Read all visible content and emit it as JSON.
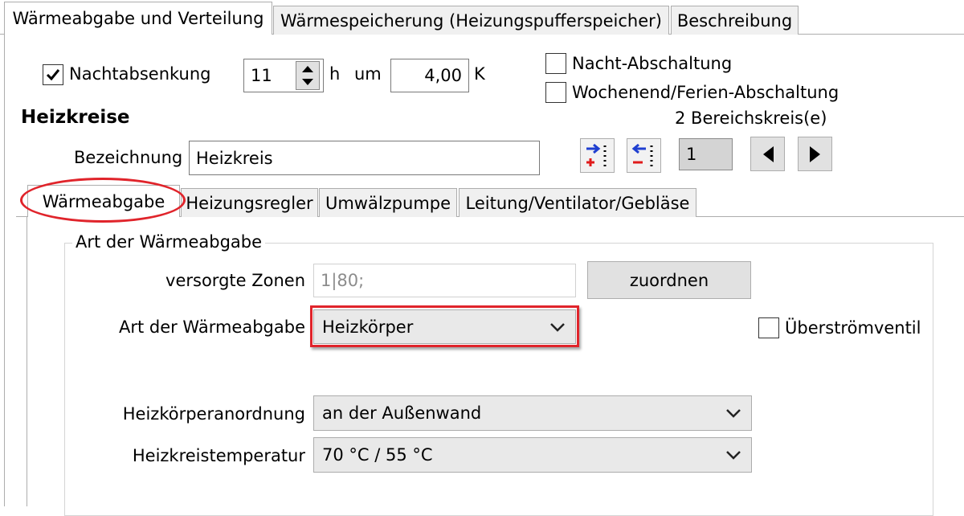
{
  "top_tabs": [
    {
      "label": "Wärmeabgabe und Verteilung"
    },
    {
      "label": "Wärmespeicherung (Heizungspufferspeicher)"
    },
    {
      "label": "Beschreibung"
    }
  ],
  "night": {
    "nachtabsenkung_label": "Nachtabsenkung",
    "hours_value": "11",
    "hours_unit": "h",
    "um_label": "um",
    "kelvin_value": "4,00",
    "kelvin_unit": "K",
    "nacht_abschaltung_label": "Nacht-Abschaltung",
    "wochenend_label": "Wochenend/Ferien-Abschaltung"
  },
  "heizkreise": {
    "heading": "Heizkreise",
    "count_label": "2 Bereichskreis(e)",
    "bezeichnung_label": "Bezeichnung",
    "bezeichnung_value": "Heizkreis",
    "index_value": "1"
  },
  "sub_tabs": [
    {
      "label": "Wärmeabgabe"
    },
    {
      "label": "Heizungsregler"
    },
    {
      "label": "Umwälzpumpe"
    },
    {
      "label": "Leitung/Ventilator/Gebläse"
    }
  ],
  "group": {
    "title": "Art der Wärmeabgabe",
    "zonen_label": "versorgte Zonen",
    "zonen_value": "1|80;",
    "zuordnen_label": "zuordnen",
    "art_label": "Art der Wärmeabgabe",
    "art_value": "Heizkörper",
    "ueberstrom_label": "Überströmventil",
    "anordnung_label": "Heizkörperanordnung",
    "anordnung_value": "an der Außenwand",
    "temperatur_label": "Heizkreistemperatur",
    "temperatur_value": "70 °C / 55 °C"
  },
  "colors": {
    "highlight": "#e0242b",
    "add_icon_blue": "#1f3fd0",
    "add_icon_red": "#e01b1b"
  }
}
